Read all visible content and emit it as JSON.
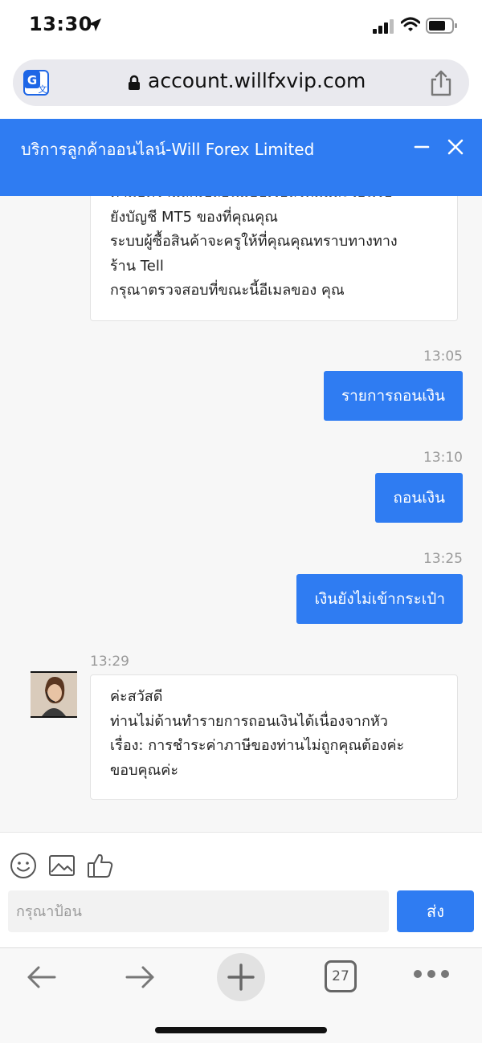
{
  "status_bar": {
    "time": "13:30",
    "icons": [
      "location-arrow-icon",
      "signal-icon",
      "wifi-icon",
      "battery-icon"
    ]
  },
  "browser": {
    "url": "account.willfxvip.com",
    "icons": [
      "translate-icon",
      "lock-icon",
      "share-icon"
    ]
  },
  "chat_header": {
    "title": "บริการลูกค้าออนไลน์-Will Forex Limited",
    "icons": [
      "minimize-icon",
      "close-icon"
    ]
  },
  "messages": [
    {
      "sender": "agent",
      "lines": [
        "ตามอัตราแลกเปลี่ยนแบบเรียลไทม์และโอนไป",
        "ยังบัญชี MT5 ของที่คุณคุณ",
        "ระบบผู้ซื้อสินค้าจะครูให้ที่คุณคุณทราบทางทาง",
        "ร้าน Tell",
        "กรุณาตรวจสอบที่ขณะนี้อีเมลของ คุณ"
      ]
    },
    {
      "sender": "user",
      "time": "13:05",
      "text": "รายการถอนเงิน"
    },
    {
      "sender": "user",
      "time": "13:10",
      "text": "ถอนเงิน"
    },
    {
      "sender": "user",
      "time": "13:25",
      "text": "เงินยังไม่เข้ากระเป๋า"
    },
    {
      "sender": "agent",
      "time": "13:29",
      "lines": [
        "ค่ะสวัสดี",
        "ท่านไม่ด้านทำรายการถอนเงินได้เนื่องจากหัว",
        "เรื่อง: การชำระค่าภาษีของท่านไม่ถูกคุณต้องค่ะ",
        "ขอบคุณค่ะ"
      ]
    }
  ],
  "composer": {
    "placeholder": "กรุณาป้อน",
    "send_label": "ส่ง",
    "tools": [
      "smiley-icon",
      "image-icon",
      "like-icon"
    ]
  },
  "bottom_toolbar": {
    "tab_count": "27",
    "icons": [
      "back-icon",
      "forward-icon",
      "new-tab-icon",
      "tabs-icon",
      "more-icon"
    ]
  },
  "colors": {
    "accent": "#2f7cf2",
    "chat_background": "#f7f7f7",
    "timestamp": "#9a9a9a"
  }
}
